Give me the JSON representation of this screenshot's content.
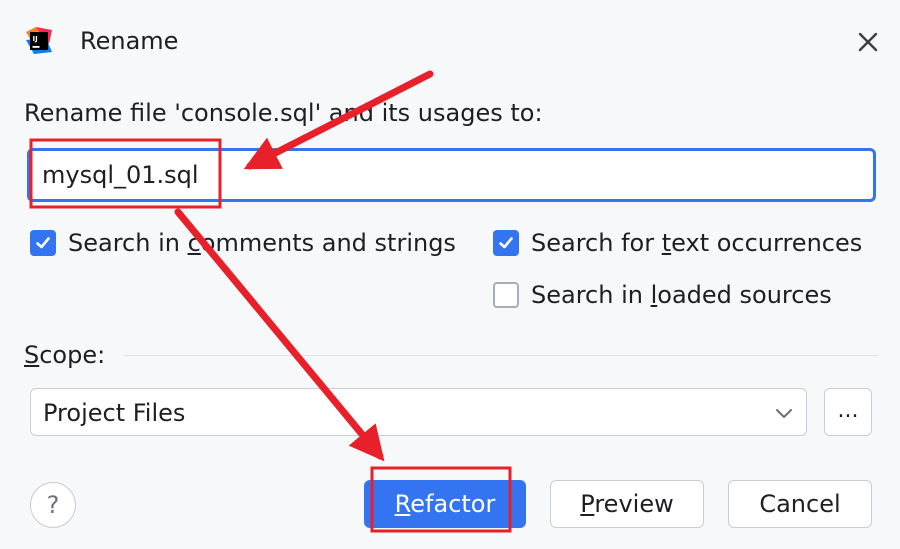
{
  "window": {
    "title": "Rename",
    "app_icon": "intellij-idea-icon",
    "close_icon": "close-icon"
  },
  "form": {
    "prompt": "Rename file 'console.sql' and its usages to:",
    "new_name_value": "mysql_01.sql"
  },
  "options": {
    "comments": {
      "before": "Search in ",
      "mnemonic": "c",
      "after": "omments and strings",
      "checked": true
    },
    "text": {
      "before": "Search for ",
      "mnemonic": "t",
      "after": "ext occurrences",
      "checked": true
    },
    "loaded": {
      "before": "Search in ",
      "mnemonic": "l",
      "after": "oaded sources",
      "checked": false
    }
  },
  "scope": {
    "label_mnemonic": "S",
    "label_rest": "cope:",
    "selected": "Project Files",
    "browse_label": "..."
  },
  "buttons": {
    "help": "?",
    "refactor_mnemonic": "R",
    "refactor_rest": "efactor",
    "preview_mnemonic": "P",
    "preview_rest": "review",
    "cancel": "Cancel"
  },
  "colors": {
    "accent": "#3574f0",
    "annotation": "#e8202a"
  }
}
